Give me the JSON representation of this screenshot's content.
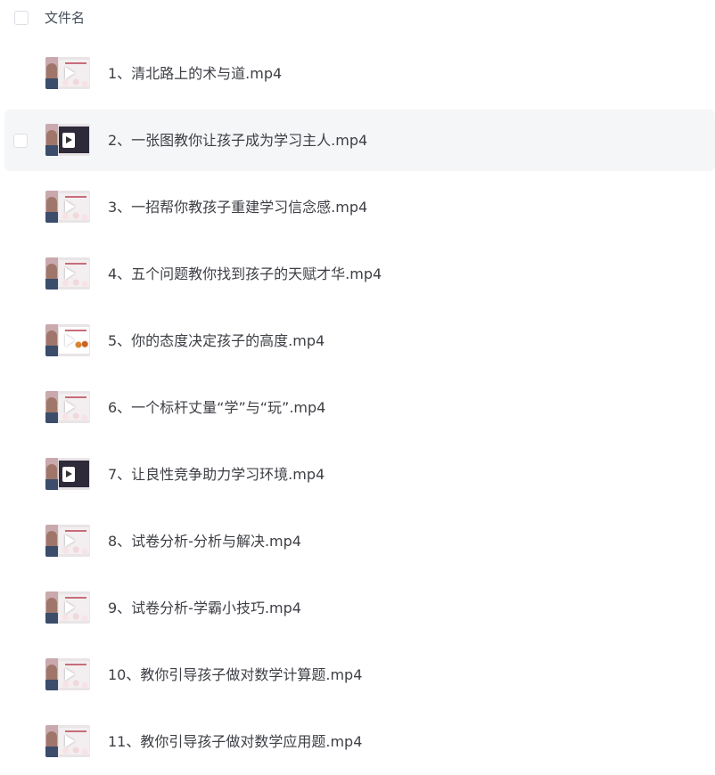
{
  "header": {
    "column_label": "文件名"
  },
  "files": [
    {
      "name": "1、清北路上的术与道.mp4",
      "thumb": "video-thumbnail"
    },
    {
      "name": "2、一张图教你让孩子成为学习主人.mp4",
      "thumb": "video-thumbnail"
    },
    {
      "name": "3、一招帮你教孩子重建学习信念感.mp4",
      "thumb": "video-thumbnail"
    },
    {
      "name": "4、五个问题教你找到孩子的天赋才华.mp4",
      "thumb": "video-thumbnail"
    },
    {
      "name": "5、你的态度决定孩子的高度.mp4",
      "thumb": "video-thumbnail"
    },
    {
      "name": "6、一个标杆丈量“学”与“玩”.mp4",
      "thumb": "video-thumbnail"
    },
    {
      "name": "7、让良性竞争助力学习环境.mp4",
      "thumb": "video-thumbnail"
    },
    {
      "name": "8、试卷分析-分析与解决.mp4",
      "thumb": "video-thumbnail"
    },
    {
      "name": "9、试卷分析-学霸小技巧.mp4",
      "thumb": "video-thumbnail"
    },
    {
      "name": "10、教你引导孩子做对数学计算题.mp4",
      "thumb": "video-thumbnail"
    },
    {
      "name": "11、教你引导孩子做对数学应用题.mp4",
      "thumb": "video-thumbnail"
    }
  ],
  "colors": {
    "hover_row_bg": "#f5f6f8",
    "text": "#3d3f45",
    "checkbox_border": "#dcdfe6"
  }
}
